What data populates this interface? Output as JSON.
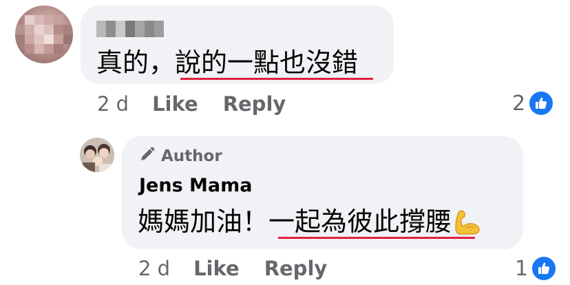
{
  "comments": [
    {
      "author": "",
      "author_blurred": true,
      "text": "真的，說的一點也沒錯",
      "meta": {
        "time": "2 d",
        "like_label": "Like",
        "reply_label": "Reply"
      },
      "reactions": {
        "count": "2",
        "icon": "thumbs-up-icon"
      }
    },
    {
      "badge": "Author",
      "badge_icon": "pencil-icon",
      "author": "Jens Mama",
      "text": "媽媽加油！一起為彼此撐腰",
      "emoji": "flexed-biceps-emoji",
      "meta": {
        "time": "2 d",
        "like_label": "Like",
        "reply_label": "Reply"
      },
      "reactions": {
        "count": "1",
        "icon": "thumbs-up-icon"
      }
    }
  ],
  "colors": {
    "bubble": "#f0f2f5",
    "meta_text": "#65676b",
    "like_blue": "#1877f2",
    "underline_red": "#e41e3f"
  }
}
